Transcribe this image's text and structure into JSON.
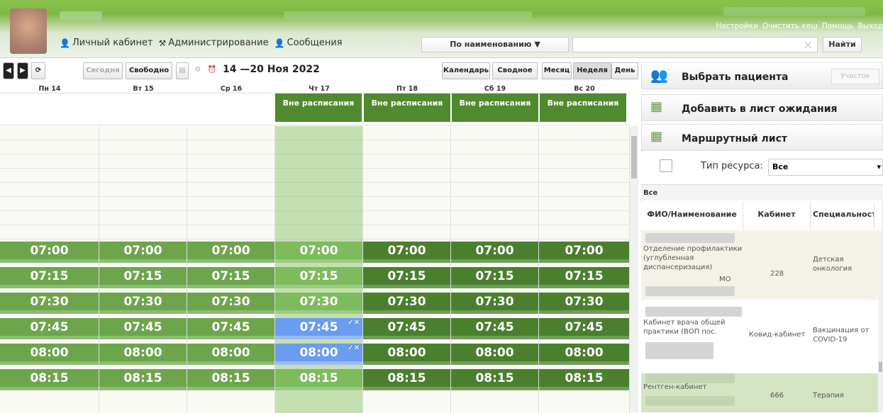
{
  "header": {
    "menu": [
      {
        "icon": "person-icon",
        "label": "Личный кабинет"
      },
      {
        "icon": "tools-icon",
        "label": "Администрирование"
      },
      {
        "icon": "person-icon",
        "label": "Сообщения"
      }
    ],
    "links": [
      "Настройки",
      "Очистить кеш",
      "Помощь",
      "Выход"
    ],
    "search_mode": "По наименованию ▼",
    "search_value": "",
    "find_label": "Найти"
  },
  "toolbar": {
    "today_label": "Сегодня",
    "free_label": "Свободно",
    "date_range": "14 —20 Ноя 2022",
    "calendar_label": "Календарь",
    "summary_label": "Сводное",
    "views": [
      "Месяц",
      "Неделя",
      "День"
    ],
    "active_view": "Неделя"
  },
  "days": [
    {
      "label": "Пн 14",
      "banner": ""
    },
    {
      "label": "Вт 15",
      "banner": ""
    },
    {
      "label": "Ср 16",
      "banner": ""
    },
    {
      "label": "Чт 17",
      "banner": "Вне расписания"
    },
    {
      "label": "Пт 18",
      "banner": "Вне расписания"
    },
    {
      "label": "Сб 19",
      "banner": "Вне расписания"
    },
    {
      "label": "Вс 20",
      "banner": "Вне расписания"
    }
  ],
  "times": [
    "07:00",
    "07:15",
    "07:30",
    "07:45",
    "08:00",
    "08:15"
  ],
  "selected_slots": [
    [
      3,
      3
    ],
    [
      3,
      4
    ]
  ],
  "slot_check": "✓✕",
  "colors": {
    "slot_light": "#6da54d",
    "slot_dark": "#4a7f2e",
    "slot_today": "#7dbb5d",
    "selected": "#6a9cef"
  },
  "right_panel": {
    "choose_patient": "Выбрать пациента",
    "uchastok": "Участок",
    "add_waitlist": "Добавить в лист ожидания",
    "route_sheet": "Маршрутный лист",
    "resource_type_label": "Тип ресурса:",
    "resource_type_value": "Все",
    "group_label": "Все",
    "columns": [
      "ФИО/Наименование",
      "Кабинет",
      "Специальность"
    ],
    "rows": [
      {
        "name": "Отделение профилактики (углубленная диспансеризация)",
        "name_tail": "МО",
        "cabinet": "228",
        "specialty": "Детская онкология"
      },
      {
        "name": "Кабинет врача общей практики (ВОП пос.",
        "name_tail": "",
        "cabinet": "Ковид-кабинет",
        "specialty": "Вакцинация от COVID-19"
      },
      {
        "name": "Рентген-кабинет",
        "name_tail": "",
        "cabinet": "666",
        "specialty": "Терапия"
      }
    ]
  }
}
